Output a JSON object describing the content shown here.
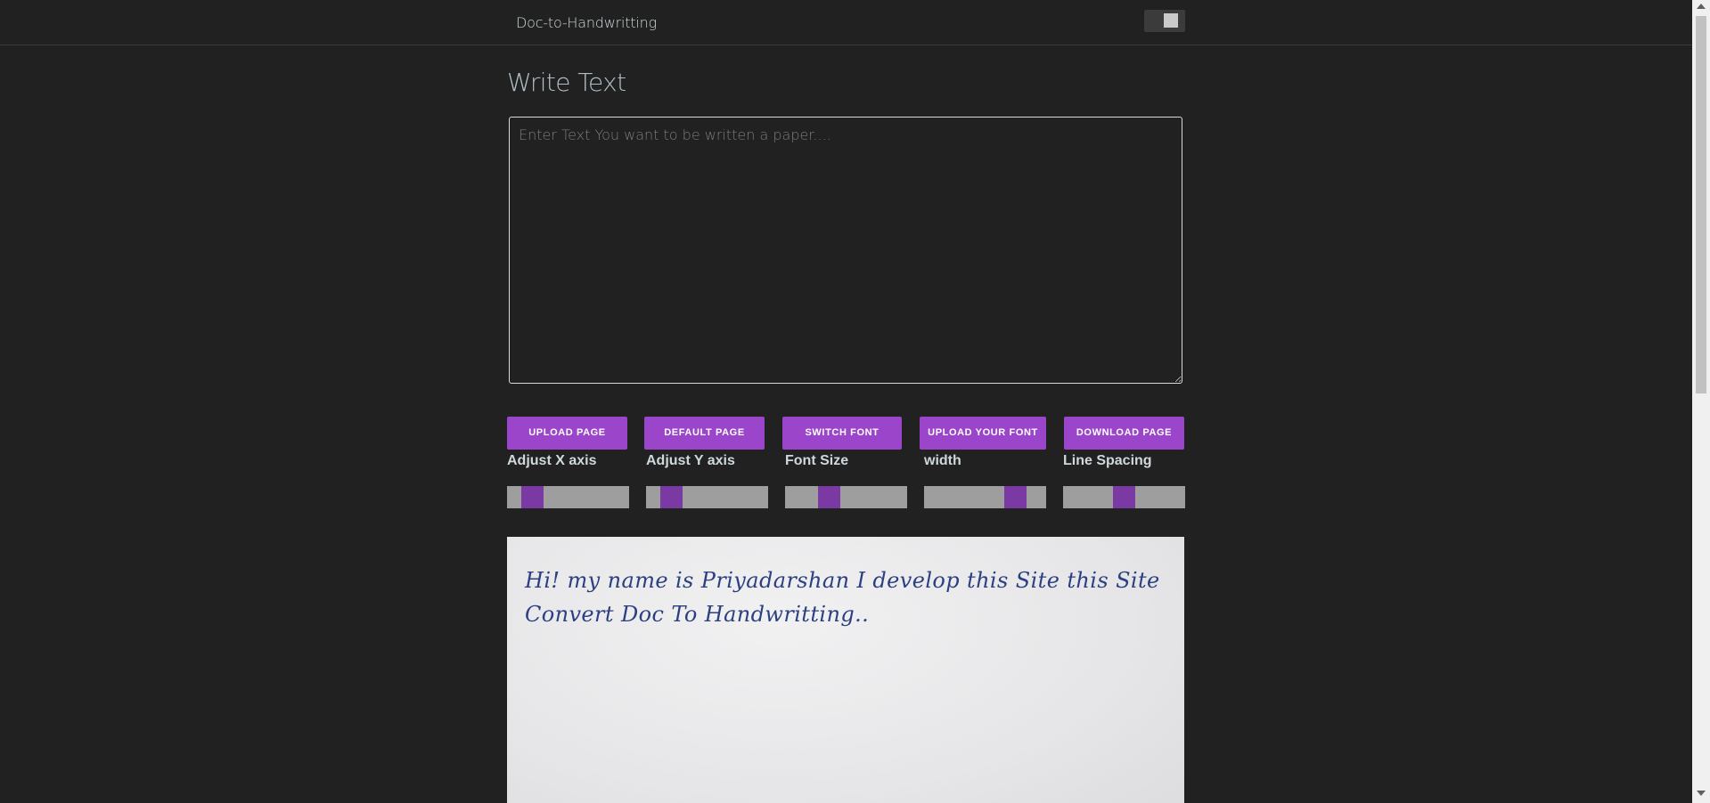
{
  "nav": {
    "brand": "Doc-to-Handwritting",
    "theme_toggle_icon": "toggle-icon"
  },
  "page": {
    "title": "Write Text"
  },
  "editor": {
    "placeholder": "Enter Text You want to be written a paper....",
    "value": ""
  },
  "buttons": {
    "upload_page": "UPLOAD PAGE",
    "default_page": "DEFAULT PAGE",
    "switch_font": "SWITCH FONT",
    "upload_font": "UPLOAD YOUR FONT",
    "download_page": "DOWNLOAD PAGE"
  },
  "controls": [
    {
      "label": "Adjust X axis",
      "value": 0.14
    },
    {
      "label": "Adjust Y axis",
      "value": 0.14
    },
    {
      "label": "Font Size",
      "value": 0.33
    },
    {
      "label": "width",
      "value": 0.8
    },
    {
      "label": "Line Spacing",
      "value": 0.5
    }
  ],
  "preview": {
    "text": "Hi! my name is Priyadarshan I develop this Site this Site Convert Doc To Handwritting.."
  },
  "colors": {
    "background": "#212121",
    "accent": "#9b45cb",
    "slider_thumb": "#7b3aa3",
    "handwriting_ink": "#2c3f80"
  }
}
